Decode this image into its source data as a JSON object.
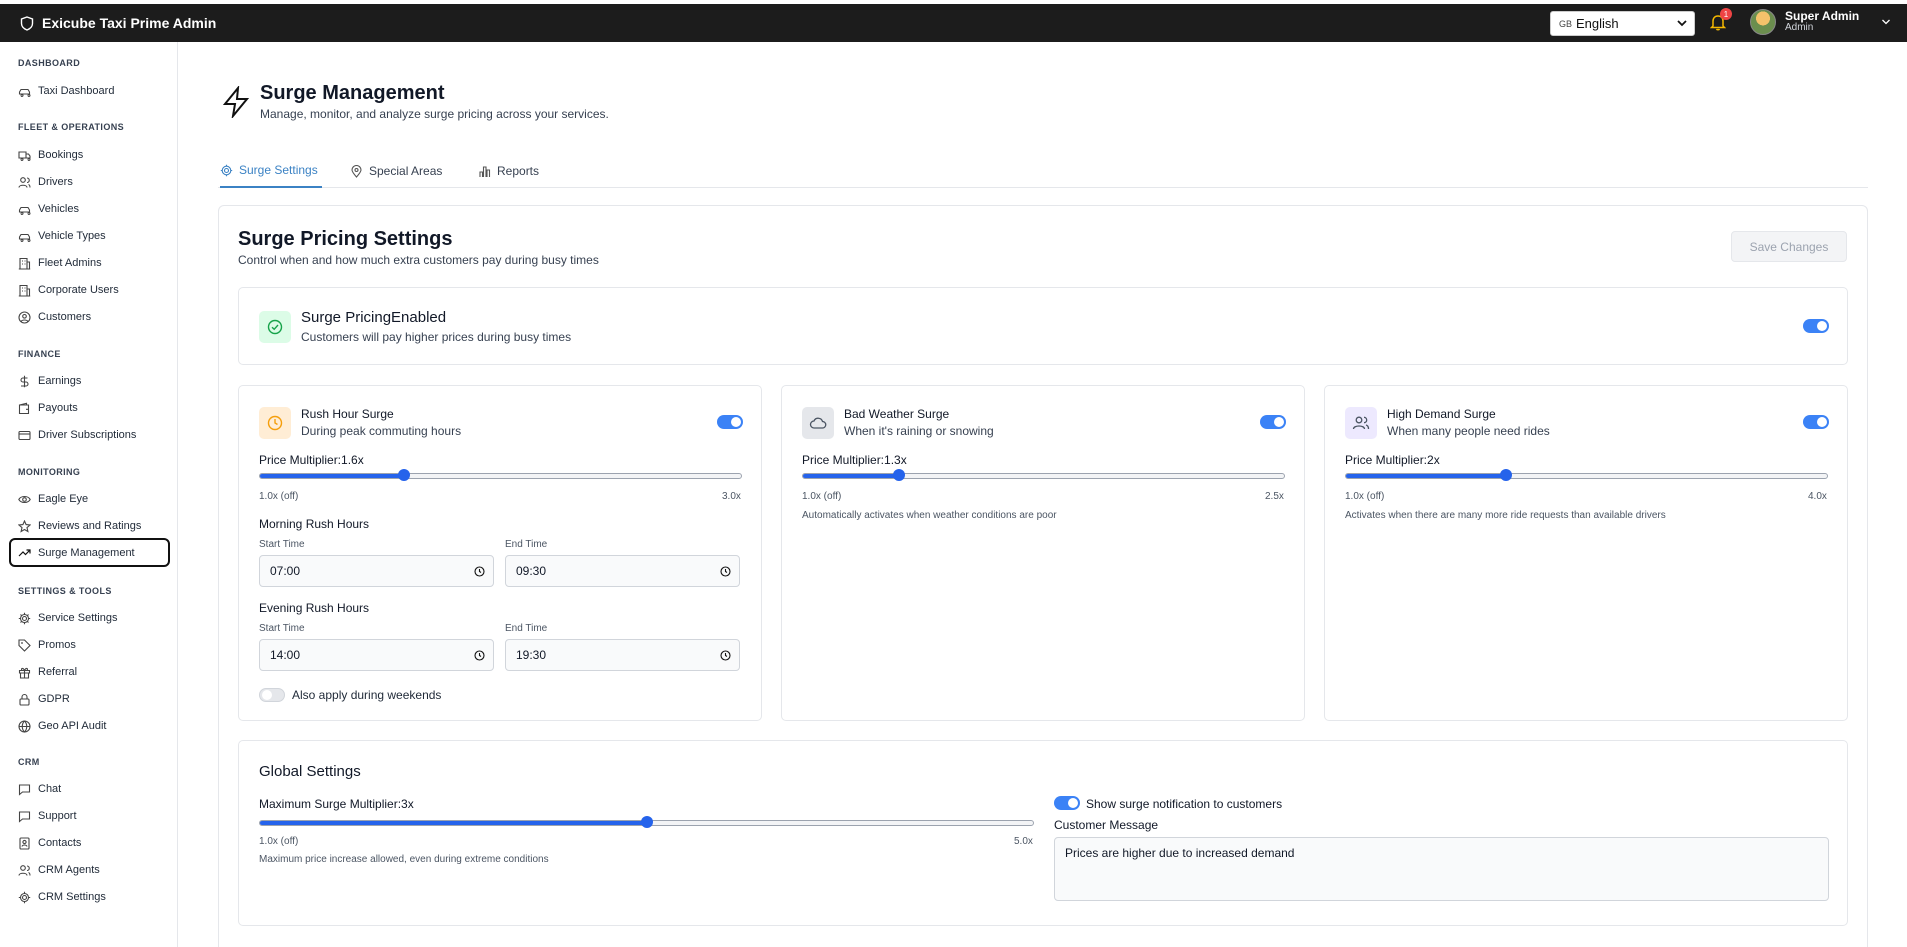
{
  "header": {
    "app_title": "Exicube Taxi Prime Admin",
    "language": {
      "flag": "GB",
      "selected": "English"
    },
    "notifications_count": "1",
    "user": {
      "name": "Super Admin",
      "role": "Admin"
    }
  },
  "sidebar": {
    "sections": [
      {
        "title": "DASHBOARD",
        "items": [
          "Taxi Dashboard"
        ]
      },
      {
        "title": "FLEET & OPERATIONS",
        "items": [
          "Bookings",
          "Drivers",
          "Vehicles",
          "Vehicle Types",
          "Fleet Admins",
          "Corporate Users",
          "Customers"
        ]
      },
      {
        "title": "FINANCE",
        "items": [
          "Earnings",
          "Payouts",
          "Driver Subscriptions"
        ]
      },
      {
        "title": "MONITORING",
        "items": [
          "Eagle Eye",
          "Reviews and Ratings",
          "Surge Management"
        ]
      },
      {
        "title": "SETTINGS & TOOLS",
        "items": [
          "Service Settings",
          "Promos",
          "Referral",
          "GDPR",
          "Geo API Audit"
        ]
      },
      {
        "title": "CRM",
        "items": [
          "Chat",
          "Support",
          "Contacts",
          "CRM Agents",
          "CRM Settings"
        ]
      }
    ],
    "active_item": "Surge Management"
  },
  "page": {
    "title": "Surge Management",
    "subtitle": "Manage, monitor, and analyze surge pricing across your services.",
    "tabs": [
      "Surge Settings",
      "Special Areas",
      "Reports"
    ],
    "active_tab": "Surge Settings"
  },
  "settings": {
    "title": "Surge Pricing Settings",
    "subtitle": "Control when and how much extra customers pay during busy times",
    "save_label": "Save Changes",
    "status": {
      "title": "Surge PricingEnabled",
      "subtitle": "Customers will pay higher prices during busy times",
      "enabled": true
    },
    "rush_hour": {
      "title": "Rush Hour Surge",
      "subtitle": "During peak commuting hours",
      "enabled": true,
      "multiplier_label": "Price Multiplier:1.6x",
      "multiplier": 1.6,
      "min": 1.0,
      "max": 3.0,
      "min_label": "1.0x (off)",
      "max_label": "3.0x",
      "morning_title": "Morning Rush Hours",
      "evening_title": "Evening Rush Hours",
      "start_label": "Start Time",
      "end_label": "End Time",
      "morning_start": "07:00",
      "morning_end": "09:30",
      "evening_start": "14:00",
      "evening_end": "19:30",
      "weekends_label": "Also apply during weekends",
      "weekends_enabled": false
    },
    "bad_weather": {
      "title": "Bad Weather Surge",
      "subtitle": "When it's raining or snowing",
      "enabled": true,
      "multiplier_label": "Price Multiplier:1.3x",
      "multiplier": 1.3,
      "min": 1.0,
      "max": 2.5,
      "min_label": "1.0x (off)",
      "max_label": "2.5x",
      "note": "Automatically activates when weather conditions are poor"
    },
    "high_demand": {
      "title": "High Demand Surge",
      "subtitle": "When many people need rides",
      "enabled": true,
      "multiplier_label": "Price Multiplier:2x",
      "multiplier": 2.0,
      "min": 1.0,
      "max": 4.0,
      "min_label": "1.0x (off)",
      "max_label": "4.0x",
      "note": "Activates when there are many more ride requests than available drivers"
    },
    "global": {
      "title": "Global Settings",
      "max_label": "Maximum Surge Multiplier:3x",
      "multiplier": 3.0,
      "min": 1.0,
      "max": 5.0,
      "min_label": "1.0x (off)",
      "max_tick": "5.0x",
      "note": "Maximum price increase allowed, even during extreme conditions",
      "notify_label": "Show surge notification to customers",
      "notify_enabled": true,
      "message_label": "Customer Message",
      "message": "Prices are higher due to increased demand"
    }
  },
  "colors": {
    "accent": "#3b82f6",
    "header_bg": "#1c1c1c"
  }
}
